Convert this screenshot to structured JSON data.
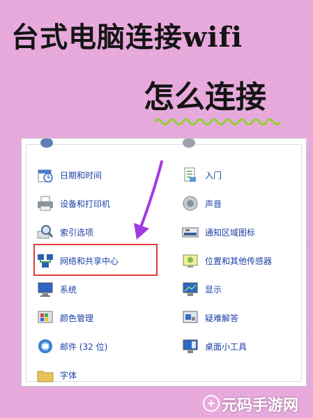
{
  "title": {
    "line1": "台式电脑连接wifi",
    "line2": "怎么连接"
  },
  "control_panel": {
    "left_items": [
      {
        "label": "日期和时间",
        "icon": "clock-calendar-icon"
      },
      {
        "label": "设备和打印机",
        "icon": "printer-icon"
      },
      {
        "label": "索引选项",
        "icon": "magnifier-icon"
      },
      {
        "label": "网络和共享中心",
        "icon": "network-icon"
      },
      {
        "label": "系统",
        "icon": "computer-icon"
      },
      {
        "label": "颜色管理",
        "icon": "color-palette-icon"
      },
      {
        "label": "邮件 (32 位)",
        "icon": "mail-icon"
      },
      {
        "label": "字体",
        "icon": "folder-font-icon"
      }
    ],
    "right_items": [
      {
        "label": "入门",
        "icon": "document-icon"
      },
      {
        "label": "声音",
        "icon": "speaker-icon"
      },
      {
        "label": "通知区域图标",
        "icon": "taskbar-icon"
      },
      {
        "label": "位置和其他传感器",
        "icon": "sensor-icon"
      },
      {
        "label": "显示",
        "icon": "monitor-icon"
      },
      {
        "label": "疑难解答",
        "icon": "troubleshoot-icon"
      },
      {
        "label": "桌面小工具",
        "icon": "gadget-icon"
      }
    ]
  },
  "watermark": "元码手游网",
  "colors": {
    "background": "#e7a9dc",
    "link": "#1c3fa6",
    "highlight": "#e23a3a",
    "arrow": "#a43be0",
    "squiggle": "#8fd12c"
  }
}
